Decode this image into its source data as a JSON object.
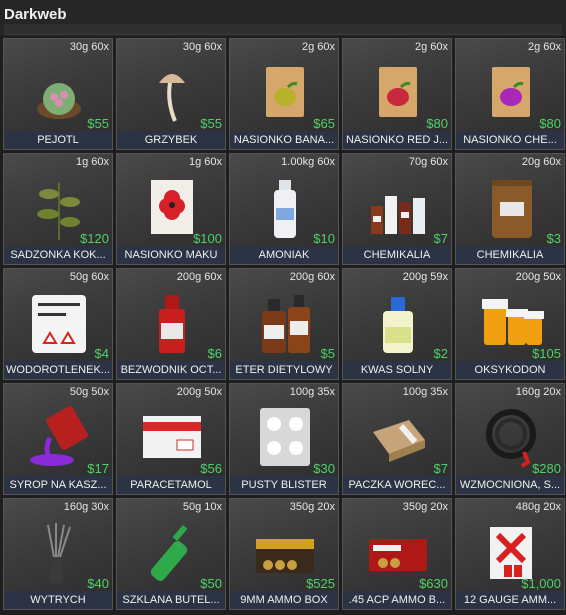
{
  "window": {
    "title": "Darkweb"
  },
  "colors": {
    "price": "#4fd16a",
    "label_bg": "#2c3344"
  },
  "items": [
    {
      "name": "PEJOTL",
      "meta": "30g 60x",
      "price": "$55",
      "icon": "cactus-icon"
    },
    {
      "name": "GRZYBEK",
      "meta": "30g 60x",
      "price": "$55",
      "icon": "mushroom-icon"
    },
    {
      "name": "NASIONKO BANA...",
      "meta": "2g 60x",
      "price": "$65",
      "icon": "seed-pack-banana-icon"
    },
    {
      "name": "NASIONKO RED J...",
      "meta": "2g 60x",
      "price": "$80",
      "icon": "seed-pack-red-icon"
    },
    {
      "name": "NASIONKO CHE...",
      "meta": "2g 60x",
      "price": "$80",
      "icon": "seed-pack-purple-icon"
    },
    {
      "name": "SADZONKA KOK...",
      "meta": "1g 60x",
      "price": "$120",
      "icon": "plant-seedling-icon"
    },
    {
      "name": "NASIONKO MAKU",
      "meta": "1g 60x",
      "price": "$100",
      "icon": "poppy-seed-pack-icon"
    },
    {
      "name": "AMONIAK",
      "meta": "1.00kg 60x",
      "price": "$10",
      "icon": "ammonia-bottle-icon"
    },
    {
      "name": "CHEMIKALIA",
      "meta": "70g 60x",
      "price": "$7",
      "icon": "chemical-bottles-icon"
    },
    {
      "name": "CHEMIKALIA",
      "meta": "20g 60x",
      "price": "$3",
      "icon": "chemical-bag-icon"
    },
    {
      "name": "WODOROTLENEK...",
      "meta": "50g 60x",
      "price": "$4",
      "icon": "hydroxide-bag-icon"
    },
    {
      "name": "BEZWODNIK OCT...",
      "meta": "200g 60x",
      "price": "$6",
      "icon": "anhydride-bottle-icon"
    },
    {
      "name": "ETER DIETYLOWY",
      "meta": "200g 60x",
      "price": "$5",
      "icon": "ether-bottles-icon"
    },
    {
      "name": "KWAS SOLNY",
      "meta": "200g 59x",
      "price": "$2",
      "icon": "acid-bottle-icon"
    },
    {
      "name": "OKSYKODON",
      "meta": "200g 50x",
      "price": "$105",
      "icon": "pill-bottles-icon"
    },
    {
      "name": "SYROP NA KASZ...",
      "meta": "50g 50x",
      "price": "$17",
      "icon": "syrup-bottle-icon"
    },
    {
      "name": "PARACETAMOL",
      "meta": "200g 50x",
      "price": "$56",
      "icon": "paracetamol-box-icon"
    },
    {
      "name": "PUSTY BLISTER",
      "meta": "100g 35x",
      "price": "$30",
      "icon": "blister-pack-icon"
    },
    {
      "name": "PACZKA WOREC...",
      "meta": "100g 35x",
      "price": "$7",
      "icon": "bag-box-icon"
    },
    {
      "name": "WZMOCNIONA, S...",
      "meta": "160g 20x",
      "price": "$280",
      "icon": "chain-hook-icon"
    },
    {
      "name": "WYTRYCH",
      "meta": "160g 30x",
      "price": "$40",
      "icon": "lockpick-icon"
    },
    {
      "name": "SZKLANA BUTEL...",
      "meta": "50g 10x",
      "price": "$50",
      "icon": "glass-bottle-icon"
    },
    {
      "name": "9MM AMMO BOX",
      "meta": "350g 20x",
      "price": "$525",
      "icon": "ammo-9mm-icon"
    },
    {
      "name": ".45 ACP AMMO B...",
      "meta": "350g 20x",
      "price": "$630",
      "icon": "ammo-45acp-icon"
    },
    {
      "name": "12 GAUGE AMM...",
      "meta": "480g 20x",
      "price": "$1,000",
      "icon": "ammo-12gauge-icon"
    }
  ]
}
